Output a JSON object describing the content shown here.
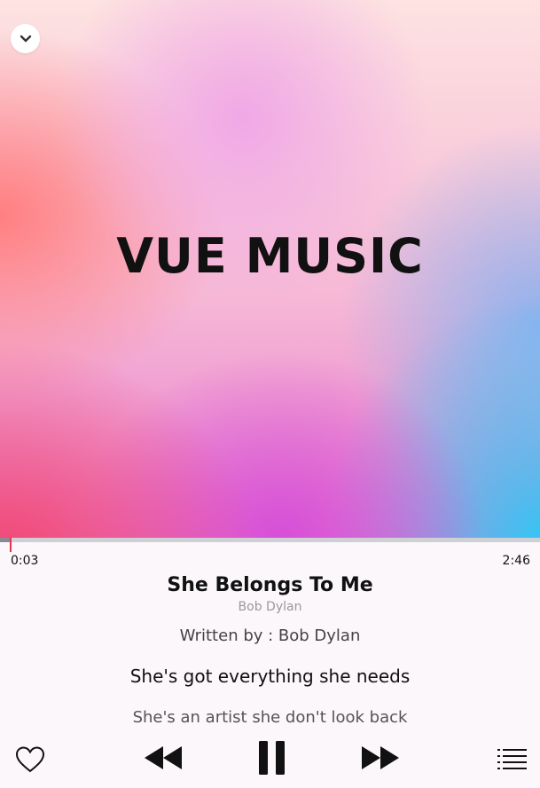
{
  "artwork": {
    "logo_text": "VUE MUSIC"
  },
  "player": {
    "current_time": "0:03",
    "total_time": "2:46",
    "progress": 0.018
  },
  "track": {
    "title": "She Belongs To Me",
    "artist": "Bob Dylan"
  },
  "lyrics": [
    "Written by : Bob Dylan",
    "She's got everything she needs",
    "She's an artist she don't look back"
  ],
  "icons": {
    "collapse": "chevron-down-icon",
    "like": "heart-icon",
    "previous": "rewind-icon",
    "play_pause": "pause-icon",
    "next": "fast-forward-icon",
    "playlist": "playlist-icon"
  },
  "colors": {
    "accent": "#e8334a",
    "progress_track": "#cfcfd6",
    "progress_fill": "#8a8a96"
  }
}
